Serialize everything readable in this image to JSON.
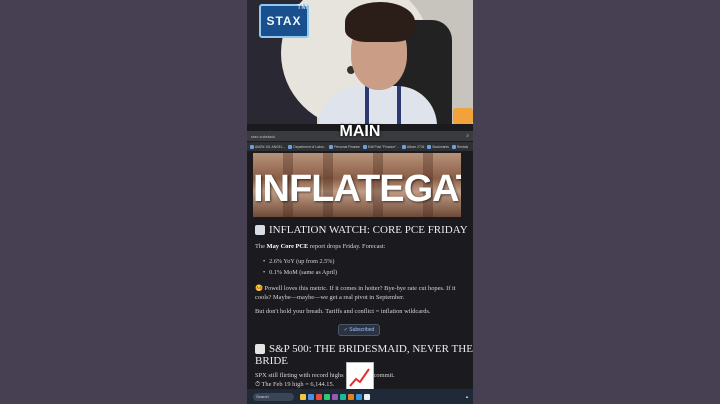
{
  "overlay": {
    "logo_text": "STAX",
    "logo_tm": "TM",
    "caption": "MAIN"
  },
  "browser": {
    "url": "stax.substack",
    "bookmarks": [
      "AMZN 101 ANGEL...",
      "Department of Labor...",
      "Personal Finance",
      "Edit Post \"Finance\"...",
      "Album 2734",
      "Bookmarks",
      "Rentals"
    ]
  },
  "article": {
    "hero_title": "INFLATEGATE",
    "section1_title": "INFLATION WATCH: CORE PCE FRIDAY",
    "intro_prefix": "The ",
    "intro_bold": "May Core PCE",
    "intro_suffix": " report drops Friday. Forecast:",
    "bullets": [
      "2.6% YoY (up from 2.5%)",
      "0.1% MoM (same as April)"
    ],
    "para1": "🤒 Powell loves this metric. If it comes in hotter? Bye-bye rate cut hopes. If it cools? Maybe—maybe—we get a real pivot in September.",
    "para2": "But don't hold your breath. Tariffs and conflict = inflation wildcards.",
    "subscribed_label": "✓ Subscribed",
    "section2_title_line1": "S&P 500: THE BRIDESMAID, NEVER THE",
    "section2_title_line2": "BRIDE",
    "para3_start": "SPX still flirting with record highs",
    "para3_end": "commit.",
    "para4": "⏱ The Feb 19 high = 6,144.15."
  },
  "taskbar": {
    "search_placeholder": "Search"
  },
  "colors": {
    "page_bg": "#474052",
    "article_bg": "#1b1b1f",
    "taskbar_bg": "#1f2937"
  }
}
